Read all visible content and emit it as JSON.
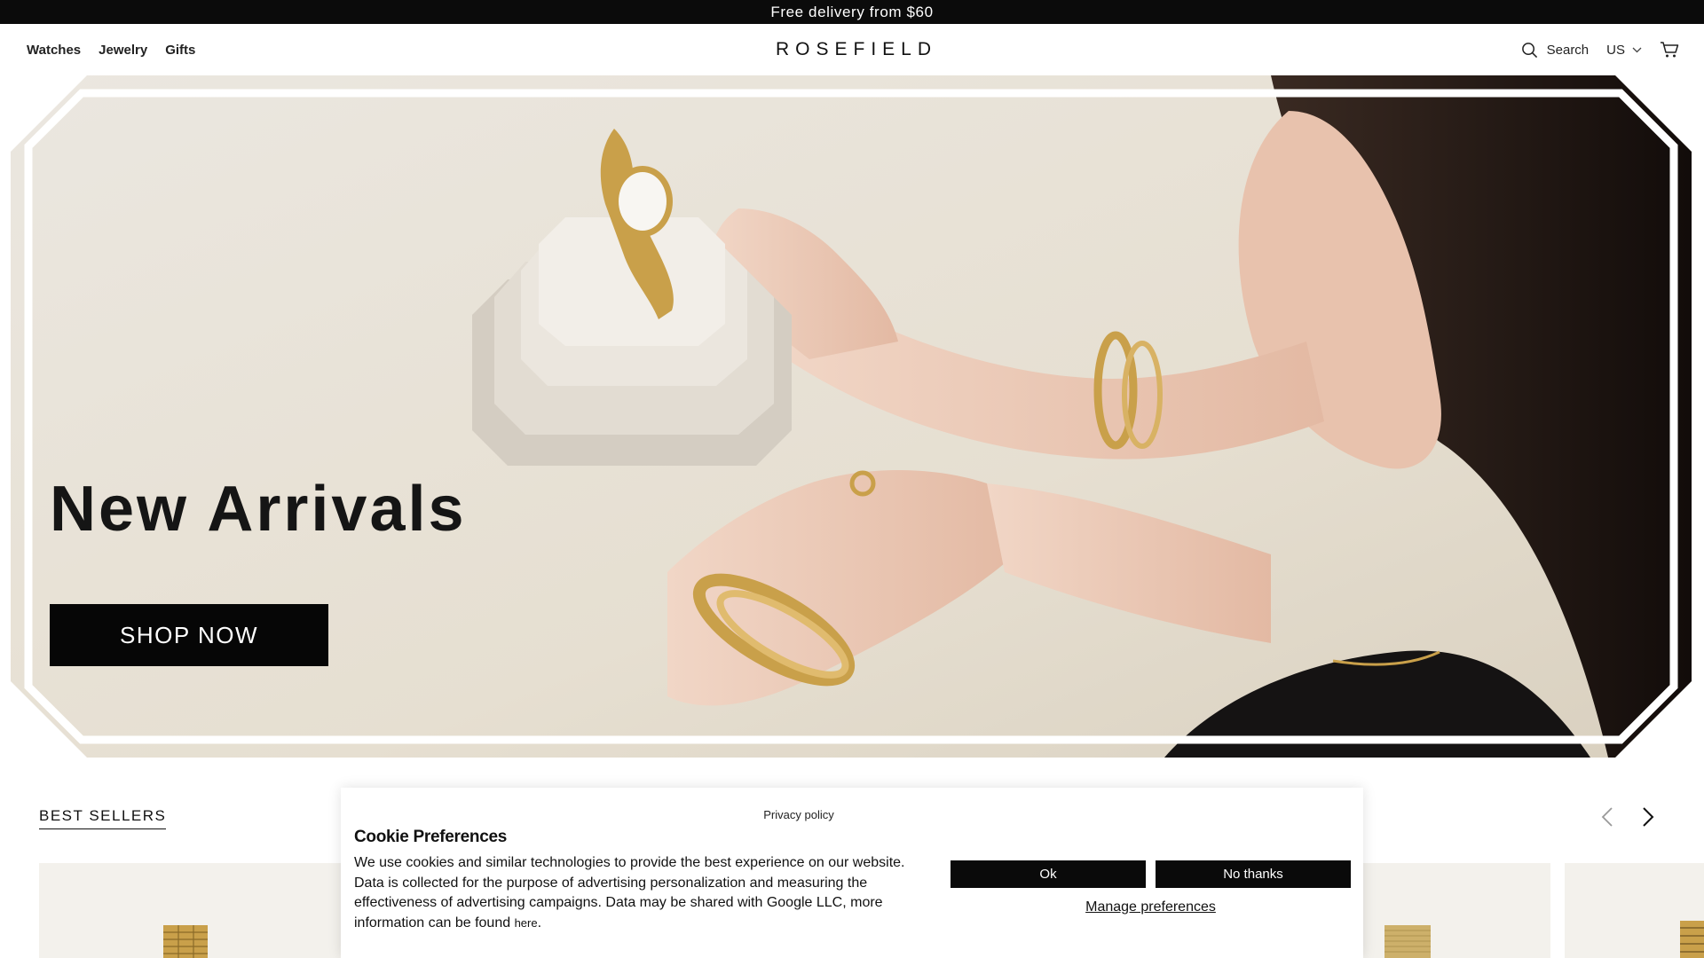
{
  "announcement": {
    "text": "Free delivery from $60"
  },
  "header": {
    "nav": [
      "Watches",
      "Jewelry",
      "Gifts"
    ],
    "logo": "ROSEFIELD",
    "search_label": "Search",
    "locale": "US"
  },
  "hero": {
    "title": "New Arrivals",
    "cta": "SHOP NOW"
  },
  "best_sellers": {
    "title": "BEST SELLERS"
  },
  "cookie": {
    "privacy_link": "Privacy policy",
    "heading": "Cookie Preferences",
    "body": "We use cookies and similar technologies to provide the best experience on our website. Data is collected for the purpose of advertising personalization and measuring the effectiveness of advertising campaigns. Data may be shared with Google LLC, more information can be found",
    "here_link": "here",
    "ok": "Ok",
    "no_thanks": "No thanks",
    "manage": "Manage preferences"
  },
  "colors": {
    "bar": "#0b0b0b",
    "hero_bg": "#e9e3d8",
    "gold": "#c9a04a",
    "button": "#060606"
  }
}
